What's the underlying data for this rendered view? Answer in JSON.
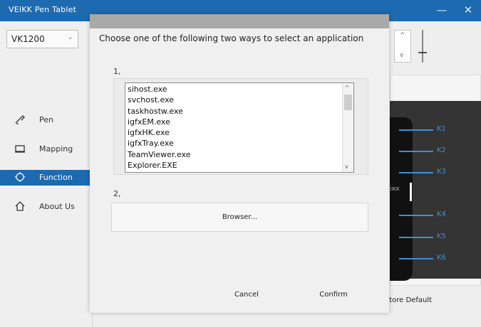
{
  "window": {
    "title": "VEIKK Pen Tablet",
    "minimize_glyph": "—",
    "close_glyph": "✕"
  },
  "left_panel": {
    "model_select": {
      "value": "VK1200",
      "chevron": "⌄"
    },
    "nav": [
      {
        "label": "Pen",
        "icon": "pen-icon",
        "active": false
      },
      {
        "label": "Mapping",
        "icon": "monitor-icon",
        "active": false
      },
      {
        "label": "Function",
        "icon": "function-icon",
        "active": true
      },
      {
        "label": "About Us",
        "icon": "home-icon",
        "active": false
      }
    ]
  },
  "background_panel": {
    "spinner": {
      "up": "^",
      "down": "v"
    },
    "keys": [
      "K1",
      "K2",
      "K3",
      "K4",
      "K5",
      "K6"
    ],
    "brand": "EIKK",
    "restore_label": "store Default"
  },
  "dialog": {
    "heading": "Choose one of the following two ways to select an application",
    "step1": "1,",
    "step2": "2,",
    "apps": [
      "sihost.exe",
      "svchost.exe",
      "taskhostw.exe",
      "igfxEM.exe",
      "igfxHK.exe",
      "igfxTray.exe",
      "TeamViewer.exe",
      "Explorer.EXE"
    ],
    "scroll_up": "^",
    "scroll_down": "v",
    "browse_label": "Browser...",
    "cancel_label": "Cancel",
    "confirm_label": "Confirm"
  },
  "colors": {
    "accent": "#1d6ab0",
    "key_blue": "#3f8fd8",
    "device_dark": "#343434"
  }
}
